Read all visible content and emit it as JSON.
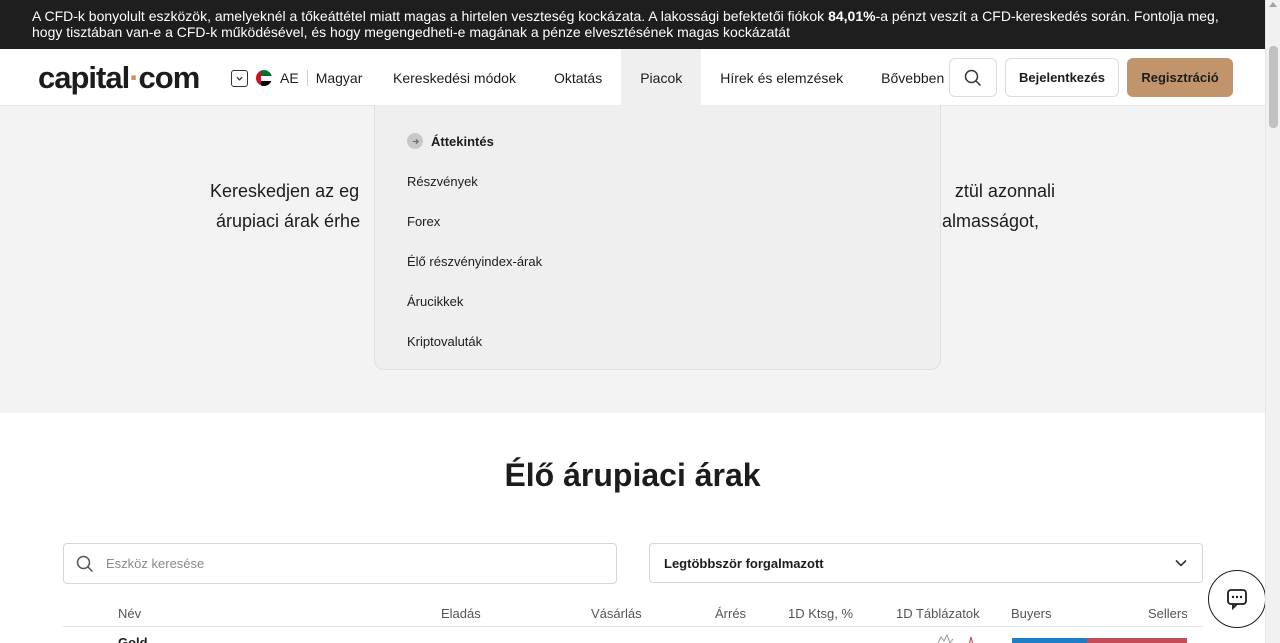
{
  "risk_banner": {
    "text_before": "A CFD-k bonyolult eszközök, amelyeknél a tőkeáttétel miatt magas a hirtelen veszteség kockázata. A lakossági befektetői fiókok ",
    "percent": "84,01%",
    "text_after": "-a pénzt veszít a CFD-kereskedés során. Fontolja meg, hogy tisztában van-e a CFD-k működésével, és hogy megengedheti-e magának a pénze elvesztésének magas kockázatát"
  },
  "header": {
    "logo_left": "capital",
    "logo_dot": "·",
    "logo_right": "com",
    "region_code": "AE",
    "language": "Magyar",
    "nav": [
      {
        "label": "Kereskedési módok"
      },
      {
        "label": "Oktatás"
      },
      {
        "label": "Piacok"
      },
      {
        "label": "Hírek és elemzések"
      },
      {
        "label": "Bővebben"
      }
    ],
    "login_label": "Bejelentkezés",
    "register_label": "Regisztráció"
  },
  "hero": {
    "line1_left": "Kereskedjen az eg",
    "line1_right": "ztül azonnali",
    "line2_left": "árupiaci árak érhe",
    "line2_right": "almasságot,"
  },
  "markets_menu": {
    "items": [
      {
        "label": "Áttekintés"
      },
      {
        "label": "Részvények"
      },
      {
        "label": "Forex"
      },
      {
        "label": "Élő részvényindex-árak"
      },
      {
        "label": "Árucikkek"
      },
      {
        "label": "Kriptovaluták"
      }
    ]
  },
  "section": {
    "title": "Élő árupiaci árak",
    "search_placeholder": "Eszköz keresése",
    "sort_value": "Legtöbbször forgalmazott"
  },
  "table": {
    "headers": [
      "Név",
      "Eladás",
      "Vásárlás",
      "Árrés",
      "1D Ktsg, %",
      "1D Táblázatok",
      "Buyers",
      "Sellers"
    ],
    "first_row_name": "Gold",
    "buyers_fraction": 0.43,
    "sellers_fraction": 0.57,
    "buyers_color": "#1f7dc6",
    "sellers_color": "#c44c58"
  },
  "colors": {
    "accent": "#c1946c",
    "banner_bg": "#1e1e1e"
  },
  "icons": [
    "chevron-down-icon",
    "uae-flag-icon",
    "search-icon",
    "arrow-right-icon",
    "chat-icon"
  ]
}
